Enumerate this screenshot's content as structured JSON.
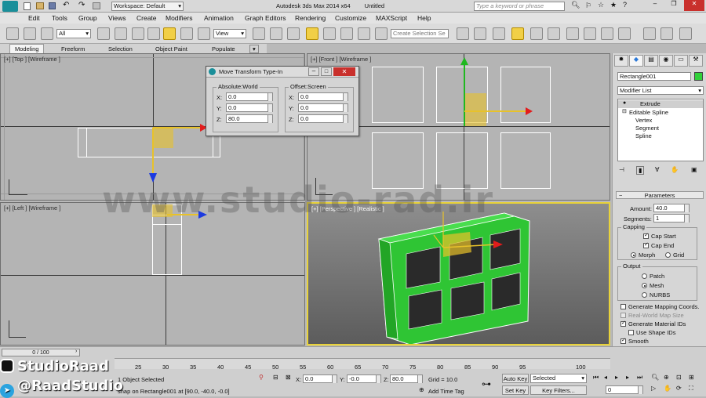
{
  "titlebar": {
    "workspace": "Workspace: Default",
    "app_title": "Autodesk 3ds Max  2014 x64",
    "file": "Untitled",
    "search_placeholder": "Type a keyword or phrase"
  },
  "menu": [
    "Edit",
    "Tools",
    "Group",
    "Views",
    "Create",
    "Modifiers",
    "Animation",
    "Graph Editors",
    "Rendering",
    "Customize",
    "MAXScript",
    "Help"
  ],
  "toolbar": {
    "selection_filter": "All",
    "ref_coord": "View",
    "named_sel": "Create Selection Se"
  },
  "ribbon": [
    "Modeling",
    "Freeform",
    "Selection",
    "Object Paint",
    "Populate"
  ],
  "viewports": {
    "top": "[+] [Top ] [Wireframe ]",
    "front": "[+] [Front ] [Wireframe ]",
    "left": "[+] [Left ] [Wireframe ]",
    "persp": "[+] [Perspective ] [Realistic ]"
  },
  "dialog": {
    "title": "Move Transform Type-In",
    "abs_title": "Absolute:World",
    "off_title": "Offset:Screen",
    "abs": {
      "x_label": "X:",
      "x": "0.0",
      "y_label": "Y:",
      "y": "0.0",
      "z_label": "Z:",
      "z": "80.0"
    },
    "off": {
      "x_label": "X:",
      "x": "0.0",
      "y_label": "Y:",
      "y": "0.0",
      "z_label": "Z:",
      "z": "0.0"
    }
  },
  "cmd": {
    "object_name": "Rectangle001",
    "object_color": "#31d13a",
    "modifier_list": "Modifier List",
    "stack": [
      "Extrude",
      "Editable Spline",
      "Vertex",
      "Segment",
      "Spline"
    ],
    "parameters": "Parameters",
    "amount_label": "Amount:",
    "amount": "40.0",
    "segments_label": "Segments:",
    "segments": "1",
    "capping": "Capping",
    "cap_start": "Cap Start",
    "cap_end": "Cap End",
    "morph": "Morph",
    "grid": "Grid",
    "output": "Output",
    "patch": "Patch",
    "mesh": "Mesh",
    "nurbs": "NURBS",
    "gen_mapping": "Generate Mapping Coords.",
    "real_world": "Real-World Map Size",
    "gen_material": "Generate Material IDs",
    "use_shape": "Use Shape IDs",
    "smooth": "Smooth"
  },
  "timeline": {
    "frame": "0 / 100",
    "ticks": [
      "25",
      "30",
      "35",
      "40",
      "45",
      "50",
      "55",
      "60",
      "65",
      "70",
      "75",
      "80",
      "85",
      "90",
      "95",
      "100"
    ]
  },
  "status": {
    "selected": "1 Object Selected",
    "prompt": "snap on Rectangle001 at [90.0, -40.0, -0.0]",
    "x_label": "X:",
    "x": "0.0",
    "y_label": "Y:",
    "y": "-0.0",
    "z_label": "Z:",
    "z": "80.0",
    "grid": "Grid = 10.0",
    "auto_key": "Auto Key",
    "selected_dd": "Selected",
    "set_key": "Set Key",
    "key_filters": "Key Filters...",
    "add_time_tag": "Add Time Tag",
    "frame_field": "0"
  },
  "overlay": {
    "watermark": "www.studio-rad.ir",
    "brand1": "StudioRaad",
    "brand2": "@RaadStudio"
  },
  "colors": {
    "accent_yellow": "#e8c22a",
    "object_green": "#31d13a",
    "axis_red": "#e21c1c",
    "axis_blue": "#1c3ae0",
    "axis_green": "#1fb81f"
  }
}
